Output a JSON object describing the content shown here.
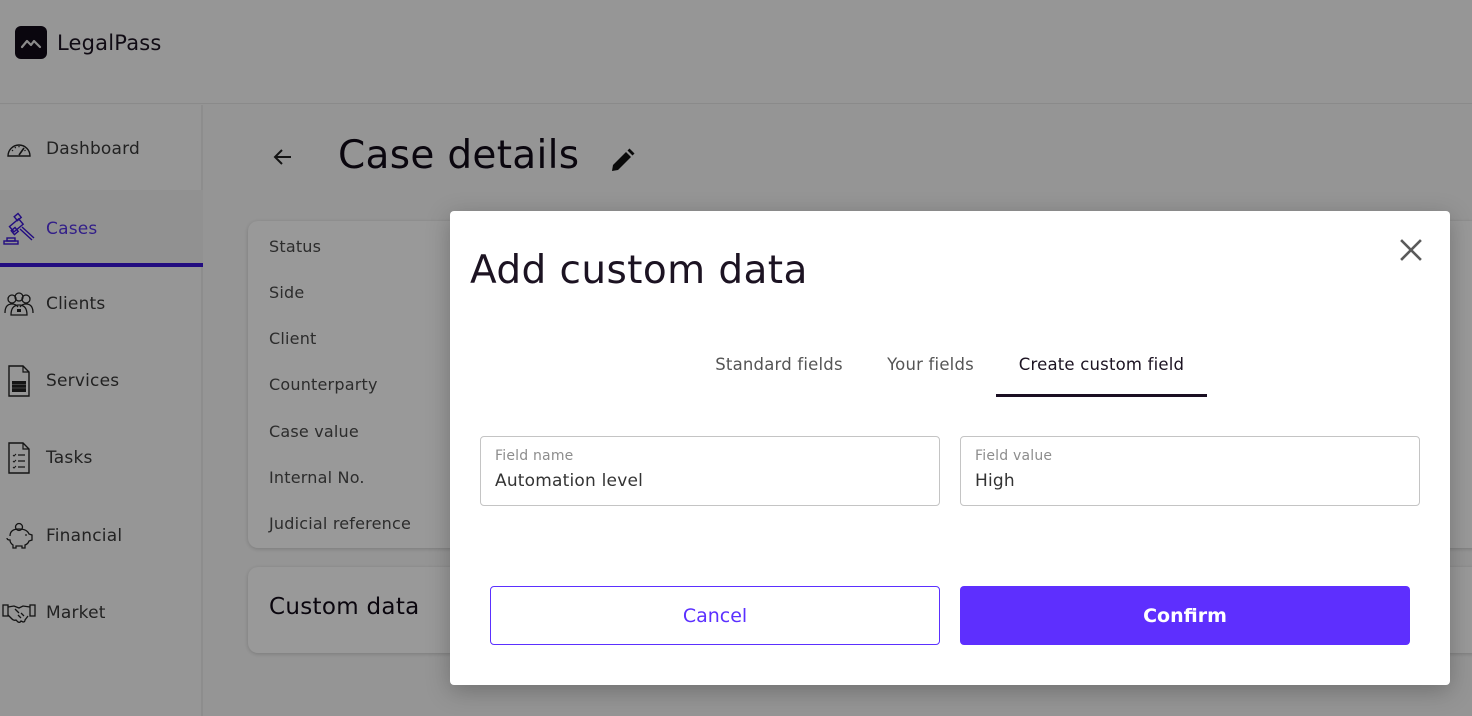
{
  "app": {
    "name": "LegalPass"
  },
  "sidebar": {
    "items": [
      {
        "label": "Dashboard",
        "icon": "speedometer-icon",
        "active": false
      },
      {
        "label": "Cases",
        "icon": "gavel-icon",
        "active": true
      },
      {
        "label": "Clients",
        "icon": "group-icon",
        "active": false
      },
      {
        "label": "Services",
        "icon": "document-icon",
        "active": false
      },
      {
        "label": "Tasks",
        "icon": "checklist-icon",
        "active": false
      },
      {
        "label": "Financial",
        "icon": "piggy-bank-icon",
        "active": false
      },
      {
        "label": "Market",
        "icon": "handshake-icon",
        "active": false
      }
    ]
  },
  "page": {
    "title": "Case details",
    "details_labels": [
      "Status",
      "Side",
      "Client",
      "Counterparty",
      "Case value",
      "Internal No.",
      "Judicial reference"
    ],
    "custom_data_title": "Custom data"
  },
  "modal": {
    "title": "Add custom data",
    "tabs": [
      {
        "label": "Standard fields",
        "active": false
      },
      {
        "label": "Your fields",
        "active": false
      },
      {
        "label": "Create custom field",
        "active": true
      }
    ],
    "fields": {
      "name": {
        "label": "Field name",
        "value": "Automation level"
      },
      "value": {
        "label": "Field value",
        "value": "High"
      }
    },
    "cancel_label": "Cancel",
    "confirm_label": "Confirm"
  },
  "colors": {
    "accent": "#5e2ffe",
    "active_nav": "#3a14d6",
    "text_dark": "#1c1322"
  }
}
